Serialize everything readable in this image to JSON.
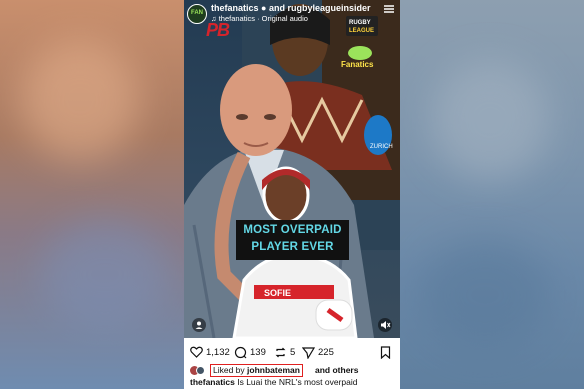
{
  "post": {
    "header": {
      "accounts": "thefanatics ● and rugbyleagueinsider",
      "audio": "♫ thefanatics · Original audio",
      "avatar_text": "FAN"
    },
    "overlay": {
      "brand_left": "PB",
      "caption_line1": "MOST OVERPAID",
      "caption_line2": "PLAYER EVER",
      "rl_logo": "RUGBY LEAGUE INSIDER",
      "fan_logo": "Fanatics"
    },
    "actions": {
      "likes_count": "1,132",
      "comments_count": "139",
      "reposts_count": "5",
      "shares_count": "225"
    },
    "liked_by": {
      "prefix": "Liked by ",
      "user": "johnbateman",
      "suffix": "and others"
    },
    "description": {
      "user": "thefanatics",
      "text": " Is Luai the NRL's most overpaid"
    }
  },
  "colors": {
    "caption_text": "#63d8e6",
    "highlight_box": "#e02020"
  },
  "icons": [
    "heart-icon",
    "comment-icon",
    "repost-icon",
    "share-icon",
    "bookmark-icon",
    "more-icon",
    "mute-icon",
    "user-tag-icon",
    "music-icon"
  ]
}
